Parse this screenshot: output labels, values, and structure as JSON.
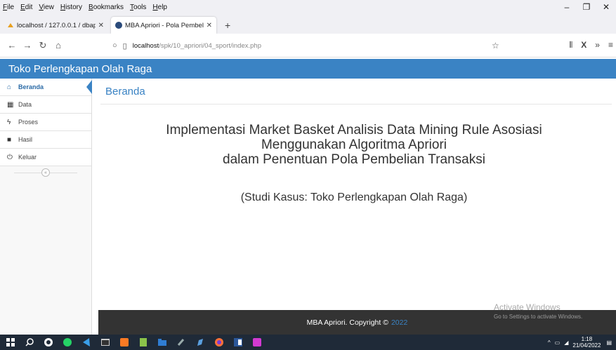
{
  "menubar": {
    "items": [
      "File",
      "Edit",
      "View",
      "History",
      "Bookmarks",
      "Tools",
      "Help"
    ]
  },
  "window": {
    "minimize": "–",
    "restore": "❐",
    "close": "✕"
  },
  "tabs": [
    {
      "label": "localhost / 127.0.0.1 / dbapriori",
      "close": "✕"
    },
    {
      "label": "MBA Apriori - Pola Pembelian P",
      "close": "✕"
    }
  ],
  "newtab": "+",
  "urlbar": {
    "host": "localhost",
    "path": "/spk/10_apriori/04_sport/index.php"
  },
  "site": {
    "header": "Toko Perlengkapan Olah Raga"
  },
  "sidebar": {
    "items": [
      {
        "label": "Beranda",
        "icon": "home-icon"
      },
      {
        "label": "Data",
        "icon": "table-icon"
      },
      {
        "label": "Proses",
        "icon": "bolt-icon"
      },
      {
        "label": "Hasil",
        "icon": "book-icon"
      },
      {
        "label": "Keluar",
        "icon": "power-icon"
      }
    ],
    "collapse": "«"
  },
  "main": {
    "title": "Beranda",
    "heading_lines": [
      "Implementasi Market Basket Analisis Data Mining Rule Asosiasi",
      "Menggunakan Algoritma Apriori",
      "dalam Penentuan Pola Pembelian Transaksi"
    ],
    "subheading": "(Studi Kasus: Toko Perlengkapan Olah Raga)"
  },
  "footer": {
    "text": "MBA Apriori. Copyright ©",
    "year": "2022"
  },
  "watermark": {
    "title": "Activate Windows",
    "subtitle": "Go to Settings to activate Windows."
  },
  "taskbar": {
    "time": "1:18",
    "date": "21/04/2022"
  },
  "colors": {
    "accent": "#3a83c4",
    "footer_bg": "#333333",
    "taskbar_bg": "#1f2a38"
  }
}
